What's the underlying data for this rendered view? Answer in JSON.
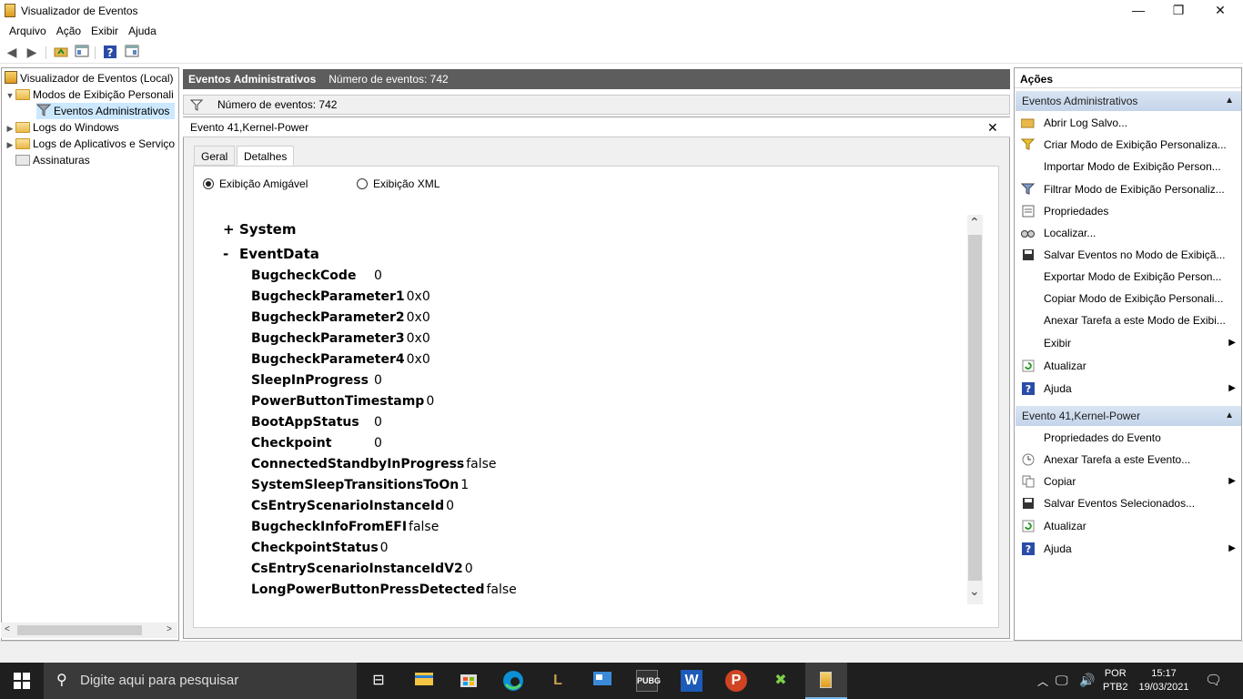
{
  "window": {
    "title": "Visualizador de Eventos",
    "minimize": "—",
    "maximize": "❐",
    "close": "✕"
  },
  "menu": [
    "Arquivo",
    "Ação",
    "Exibir",
    "Ajuda"
  ],
  "tree": {
    "root": "Visualizador de Eventos (Local)",
    "custom_views": "Modos de Exibição Personali",
    "admin_events": "Eventos Administrativos",
    "windows_logs": "Logs do Windows",
    "app_logs": "Logs de Aplicativos e Serviço",
    "subscriptions": "Assinaturas"
  },
  "center": {
    "header_title": "Eventos Administrativos",
    "header_count": "Número de eventos: 742",
    "filter_text": "Número de eventos: 742",
    "event_title": "Evento 41,Kernel-Power",
    "tabs": [
      "Geral",
      "Detalhes"
    ],
    "radio_friendly": "Exibição Amigável",
    "radio_xml": "Exibição XML",
    "system_sign": "+",
    "system_label": "System",
    "eventdata_sign": "-",
    "eventdata_label": "EventData",
    "params": [
      {
        "name": "BugcheckCode",
        "value": "0"
      },
      {
        "name": "BugcheckParameter1",
        "value": "0x0"
      },
      {
        "name": "BugcheckParameter2",
        "value": "0x0"
      },
      {
        "name": "BugcheckParameter3",
        "value": "0x0"
      },
      {
        "name": "BugcheckParameter4",
        "value": "0x0"
      },
      {
        "name": "SleepInProgress",
        "value": "0"
      },
      {
        "name": "PowerButtonTimestamp",
        "value": "0"
      },
      {
        "name": "BootAppStatus",
        "value": "0"
      },
      {
        "name": "Checkpoint",
        "value": "0"
      },
      {
        "name": "ConnectedStandbyInProgress",
        "value": "false"
      },
      {
        "name": "SystemSleepTransitionsToOn",
        "value": "1"
      },
      {
        "name": "CsEntryScenarioInstanceId",
        "value": "0"
      },
      {
        "name": "BugcheckInfoFromEFI",
        "value": "false"
      },
      {
        "name": "CheckpointStatus",
        "value": "0"
      },
      {
        "name": "CsEntryScenarioInstanceIdV2",
        "value": "0"
      },
      {
        "name": "LongPowerButtonPressDetected",
        "value": "false"
      }
    ]
  },
  "actions": {
    "header": "Ações",
    "section1": "Eventos Administrativos",
    "items1": [
      {
        "icon": "open-log-icon",
        "label": "Abrir Log Salvo..."
      },
      {
        "icon": "create-view-icon",
        "label": "Criar Modo de Exibição Personaliza..."
      },
      {
        "icon": "",
        "label": "Importar Modo de Exibição Person..."
      },
      {
        "icon": "filter-icon",
        "label": "Filtrar Modo de Exibição Personaliz..."
      },
      {
        "icon": "properties-icon",
        "label": "Propriedades"
      },
      {
        "icon": "find-icon",
        "label": "Localizar..."
      },
      {
        "icon": "save-icon",
        "label": "Salvar Eventos no Modo de Exibiçã..."
      },
      {
        "icon": "",
        "label": "Exportar Modo de Exibição Person..."
      },
      {
        "icon": "",
        "label": "Copiar Modo de Exibição Personali..."
      },
      {
        "icon": "",
        "label": "Anexar Tarefa a este Modo de Exibi..."
      },
      {
        "icon": "",
        "label": "Exibir",
        "submenu": true
      },
      {
        "icon": "refresh-icon",
        "label": "Atualizar"
      },
      {
        "icon": "help-icon",
        "label": "Ajuda",
        "submenu": true
      }
    ],
    "section2": "Evento 41,Kernel-Power",
    "items2": [
      {
        "icon": "event-properties-icon",
        "label": "Propriedades do Evento"
      },
      {
        "icon": "attach-task-icon",
        "label": "Anexar Tarefa a este Evento..."
      },
      {
        "icon": "copy-icon",
        "label": "Copiar",
        "submenu": true
      },
      {
        "icon": "save-icon",
        "label": "Salvar Eventos Selecionados..."
      },
      {
        "icon": "refresh-icon",
        "label": "Atualizar"
      },
      {
        "icon": "help-icon",
        "label": "Ajuda",
        "submenu": true
      }
    ]
  },
  "taskbar": {
    "search_placeholder": "Digite aqui para pesquisar",
    "lang1": "POR",
    "lang2": "PTB2",
    "time": "15:17",
    "date": "19/03/2021"
  }
}
